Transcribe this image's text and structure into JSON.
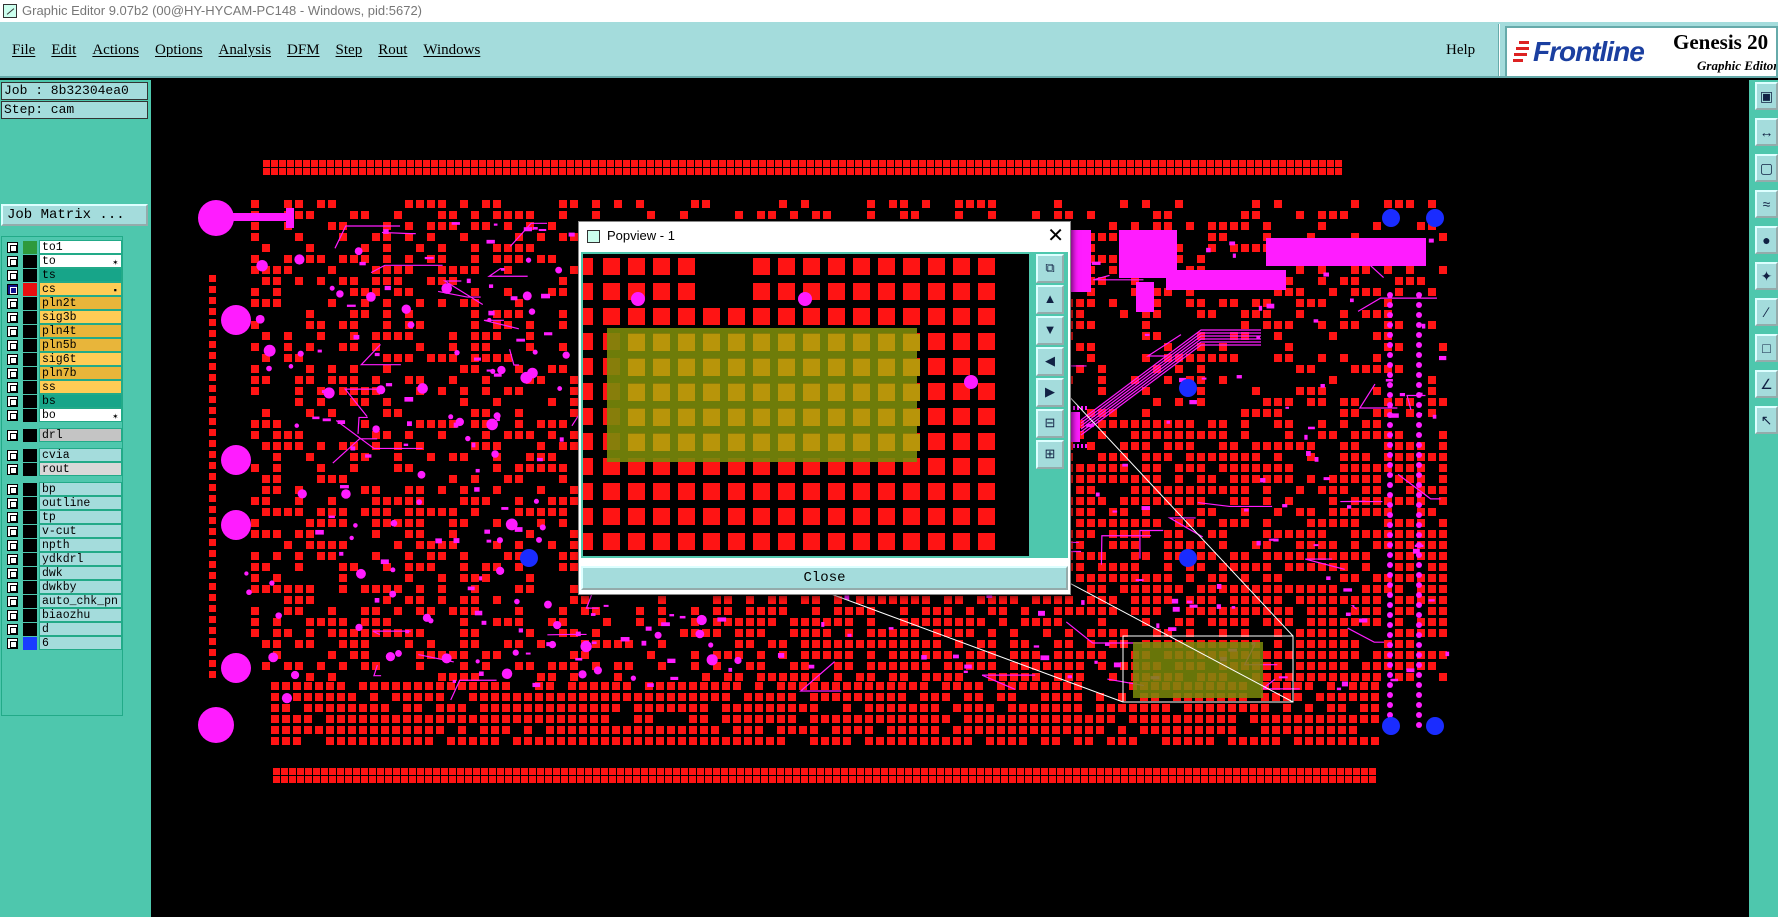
{
  "window": {
    "title": "Graphic Editor 9.07b2 (00@HY-HYCAM-PC148 - Windows, pid:5672)"
  },
  "menu": [
    "File",
    "Edit",
    "Actions",
    "Options",
    "Analysis",
    "DFM",
    "Step",
    "Rout",
    "Windows"
  ],
  "help_label": "Help",
  "brand": {
    "logo": "Frontline",
    "product": "Genesis 20",
    "subtitle": "Graphic Editor"
  },
  "job": {
    "job_label": "Job : 8b32304ea0",
    "step_label": "Step: cam",
    "matrix_button": "Job Matrix ..."
  },
  "layers": [
    {
      "name": "to1",
      "swatch": "#2e9a3c",
      "bg": "#ffffff",
      "active": false,
      "pin": ""
    },
    {
      "name": "to",
      "swatch": "#000000",
      "bg": "#ffffff",
      "active": false,
      "pin": "✶"
    },
    {
      "name": "ts",
      "swatch": "#000000",
      "bg": "#17a589",
      "active": false,
      "pin": ""
    },
    {
      "name": "cs",
      "swatch": "#e81010",
      "bg": "#ffcc55",
      "active": true,
      "pin": "▪"
    },
    {
      "name": "pln2t",
      "swatch": "#000000",
      "bg": "#e8b53a",
      "active": false,
      "pin": ""
    },
    {
      "name": "sig3b",
      "swatch": "#000000",
      "bg": "#ffcc55",
      "active": false,
      "pin": ""
    },
    {
      "name": "pln4t",
      "swatch": "#000000",
      "bg": "#e8b53a",
      "active": false,
      "pin": ""
    },
    {
      "name": "pln5b",
      "swatch": "#000000",
      "bg": "#e8b53a",
      "active": false,
      "pin": ""
    },
    {
      "name": "sig6t",
      "swatch": "#000000",
      "bg": "#ffcc55",
      "active": false,
      "pin": ""
    },
    {
      "name": "pln7b",
      "swatch": "#000000",
      "bg": "#e8b53a",
      "active": false,
      "pin": ""
    },
    {
      "name": "ss",
      "swatch": "#000000",
      "bg": "#ffcc55",
      "active": false,
      "pin": ""
    },
    {
      "name": "bs",
      "swatch": "#000000",
      "bg": "#17a589",
      "active": false,
      "pin": ""
    },
    {
      "name": "bo",
      "swatch": "#000000",
      "bg": "#ffffff",
      "active": false,
      "pin": "✶"
    },
    {
      "name": "drl",
      "swatch": "#000000",
      "bg": "#c4c4c4",
      "active": false,
      "pin": ""
    },
    {
      "name": "cvia",
      "swatch": "#000000",
      "bg": "#a4dcdc",
      "active": false,
      "pin": ""
    },
    {
      "name": "rout",
      "swatch": "#000000",
      "bg": "#d8d8d8",
      "active": false,
      "pin": ""
    },
    {
      "name": "bp",
      "swatch": "#000000",
      "bg": "#a4dcdc",
      "active": false,
      "pin": ""
    },
    {
      "name": "outline",
      "swatch": "#000000",
      "bg": "#a4dcdc",
      "active": false,
      "pin": ""
    },
    {
      "name": "tp",
      "swatch": "#000000",
      "bg": "#a4dcdc",
      "active": false,
      "pin": ""
    },
    {
      "name": "v-cut",
      "swatch": "#000000",
      "bg": "#a4dcdc",
      "active": false,
      "pin": ""
    },
    {
      "name": "npth",
      "swatch": "#000000",
      "bg": "#a4dcdc",
      "active": false,
      "pin": ""
    },
    {
      "name": "ydkdrl",
      "swatch": "#000000",
      "bg": "#a4dcdc",
      "active": false,
      "pin": ""
    },
    {
      "name": "dwk",
      "swatch": "#000000",
      "bg": "#a4dcdc",
      "active": false,
      "pin": ""
    },
    {
      "name": "dwkby",
      "swatch": "#000000",
      "bg": "#a4dcdc",
      "active": false,
      "pin": ""
    },
    {
      "name": "auto_chk_pn",
      "swatch": "#000000",
      "bg": "#a4dcdc",
      "active": false,
      "pin": ""
    },
    {
      "name": "biaozhu",
      "swatch": "#000000",
      "bg": "#a4dcdc",
      "active": false,
      "pin": ""
    },
    {
      "name": "d",
      "swatch": "#000000",
      "bg": "#a4dcdc",
      "active": false,
      "pin": ""
    },
    {
      "name": "6",
      "swatch": "#1a3cff",
      "bg": "#a4dcdc",
      "active": false,
      "pin": ""
    }
  ],
  "popview": {
    "title": "Popview - 1",
    "close_label": "Close",
    "close_x": "✕"
  },
  "colors": {
    "pad": "#ff1414",
    "feature": "#ff1cff",
    "drill": "#1a2cff",
    "highlight": "#7a8a0a",
    "panel": "#4ec7ad",
    "menu": "#a4dcdc"
  },
  "icons": {
    "right_toolbar": [
      "layer-icon",
      "move-icon",
      "fit-icon",
      "snap-icon",
      "measure-icon",
      "route-icon",
      "line-icon",
      "pad-icon",
      "angle-icon",
      "select-icon"
    ],
    "popview_toolbar": [
      "zoom-home-icon",
      "pan-up-icon",
      "pan-down-icon",
      "pan-left-icon",
      "pan-right-icon",
      "zoom-out-icon",
      "zoom-in-icon"
    ]
  }
}
